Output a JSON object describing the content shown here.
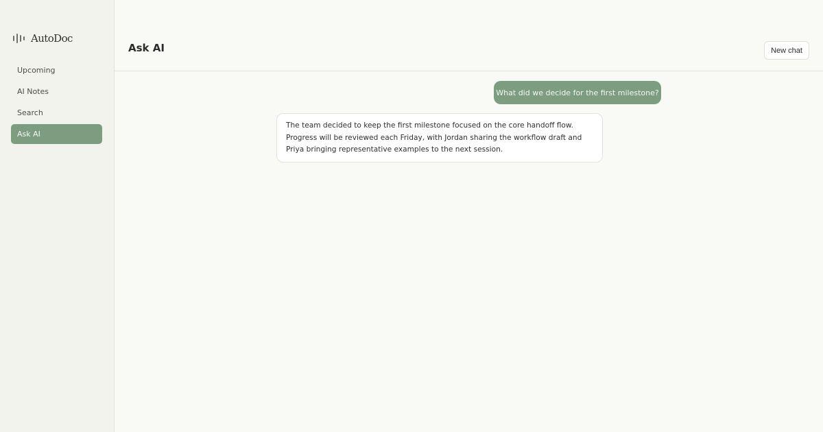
{
  "brand": {
    "name": "AutoDoc",
    "icon": "waveform-icon"
  },
  "sidebar": {
    "items": [
      {
        "label": "Upcoming",
        "active": false
      },
      {
        "label": "AI Notes",
        "active": false
      },
      {
        "label": "Search",
        "active": false
      },
      {
        "label": "Ask AI",
        "active": true
      }
    ]
  },
  "header": {
    "title": "Ask AI",
    "new_chat_label": "New chat"
  },
  "chat": {
    "messages": [
      {
        "role": "user",
        "text": "What did we decide for the first milestone?"
      },
      {
        "role": "assistant",
        "text": "The team decided to keep the first milestone focused on the core handoff flow. Progress will be reviewed each Friday, with Jordan sharing the workflow draft and Priya bringing representative examples to the next session."
      }
    ]
  },
  "colors": {
    "accent": "#7d9d81",
    "sidebar_bg": "#f3f3ee",
    "main_bg": "#f9f9f5"
  }
}
